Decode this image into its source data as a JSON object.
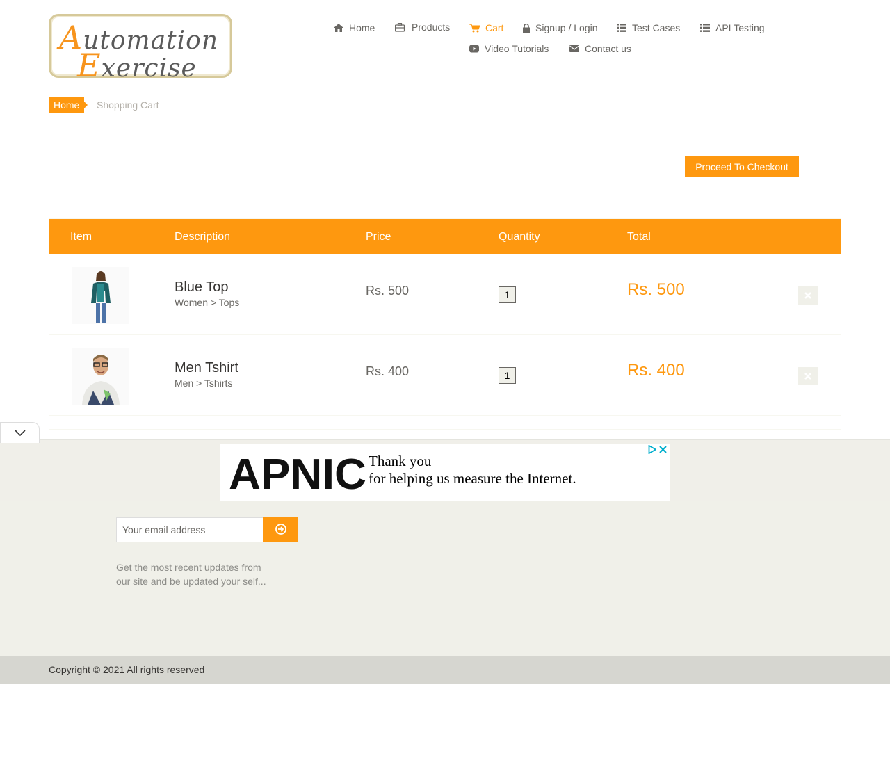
{
  "logo": {
    "line1_cap": "A",
    "line1_rest": "utomation",
    "line2_cap": "E",
    "line2_rest": "xercise"
  },
  "nav": [
    {
      "label": "Home",
      "icon": "home-icon"
    },
    {
      "label": "Products",
      "icon": "briefcase-icon"
    },
    {
      "label": "Cart",
      "icon": "cart-icon",
      "active": true
    },
    {
      "label": "Signup / Login",
      "icon": "lock-icon"
    },
    {
      "label": "Test Cases",
      "icon": "list-icon"
    },
    {
      "label": "API Testing",
      "icon": "list-icon"
    },
    {
      "label": "Video Tutorials",
      "icon": "youtube-icon"
    },
    {
      "label": "Contact us",
      "icon": "envelope-icon"
    }
  ],
  "breadcrumb": {
    "home": "Home",
    "current": "Shopping Cart"
  },
  "checkout_label": "Proceed To Checkout",
  "table": {
    "headers": [
      "Item",
      "Description",
      "Price",
      "Quantity",
      "Total"
    ],
    "rows": [
      {
        "name": "Blue Top",
        "category": "Women > Tops",
        "price": "Rs. 500",
        "quantity": "1",
        "total": "Rs. 500"
      },
      {
        "name": "Men Tshirt",
        "category": "Men > Tshirts",
        "price": "Rs. 400",
        "quantity": "1",
        "total": "Rs. 400"
      }
    ]
  },
  "ad": {
    "brand": "APNIC",
    "line1": "Thank you",
    "line2": "for helping us measure the Internet."
  },
  "subscribe": {
    "placeholder": "Your email address",
    "note": "Get the most recent updates from our site and be updated your self..."
  },
  "footer": {
    "copyright": "Copyright © 2021 All rights reserved"
  },
  "colors": {
    "accent": "#fe980f",
    "text": "#696763",
    "footer_bg": "#f0f0e9"
  }
}
